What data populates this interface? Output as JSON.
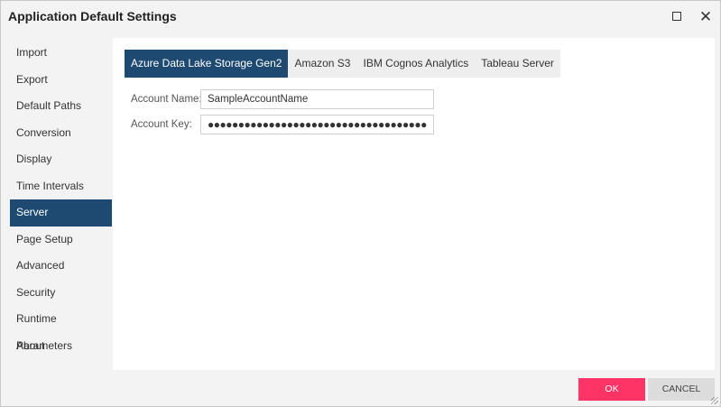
{
  "window": {
    "title": "Application Default Settings"
  },
  "sidebar": {
    "items": [
      {
        "label": "Import"
      },
      {
        "label": "Export"
      },
      {
        "label": "Default Paths"
      },
      {
        "label": "Conversion"
      },
      {
        "label": "Display"
      },
      {
        "label": "Time Intervals"
      },
      {
        "label": "Server",
        "active": true
      },
      {
        "label": "Page Setup"
      },
      {
        "label": "Advanced"
      },
      {
        "label": "Security"
      },
      {
        "label": "Runtime Parameters"
      },
      {
        "label": "About"
      }
    ]
  },
  "tabs": [
    {
      "label": "Azure Data Lake Storage Gen2",
      "active": true
    },
    {
      "label": "Amazon S3"
    },
    {
      "label": "IBM Cognos Analytics"
    },
    {
      "label": "Tableau Server"
    }
  ],
  "form": {
    "account_name_label": "Account Name:",
    "account_name_value": "SampleAccountName",
    "account_key_label": "Account Key:",
    "account_key_value": "●●●●●●●●●●●●●●●●●●●●●●●●●●●●●●●●●●●●"
  },
  "buttons": {
    "ok": "OK",
    "cancel": "CANCEL"
  },
  "colors": {
    "accent": "#1e4a72",
    "ok": "#fe3466"
  }
}
